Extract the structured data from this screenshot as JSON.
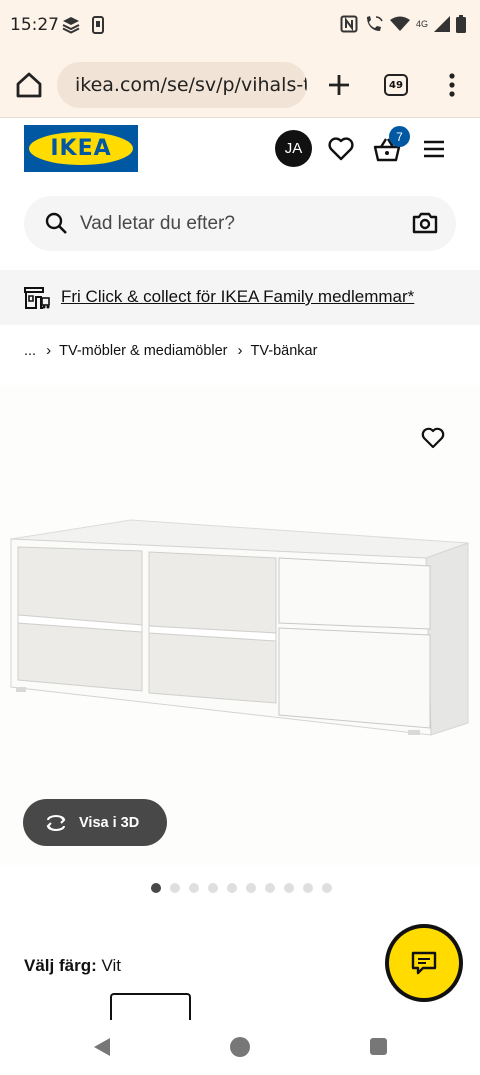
{
  "status_bar": {
    "time": "15:27",
    "network": "4G",
    "icons": [
      "stack-icon",
      "phone-outline-icon",
      "nfc-icon",
      "wifi-calling-icon",
      "wifi-icon",
      "signal-icon",
      "battery-icon"
    ]
  },
  "browser": {
    "url": "ikea.com/se/sv/p/vihals-t",
    "tab_count": "49"
  },
  "header": {
    "logo_text": "IKEA",
    "avatar_initials": "JA",
    "cart_count": "7",
    "brand_colors": {
      "blue": "#0058a3",
      "yellow": "#ffdb00"
    }
  },
  "search": {
    "placeholder": "Vad letar du efter?"
  },
  "promo": {
    "text": "Fri Click & collect för IKEA Family medlemmar*"
  },
  "breadcrumb": {
    "items": [
      "...",
      "TV-möbler & mediamöbler",
      "TV-bänkar"
    ]
  },
  "product": {
    "view_3d_label": "Visa i 3D",
    "gallery_total": 10,
    "gallery_active_index": 0,
    "color_label": "Välj färg:",
    "color_value": "Vit"
  }
}
